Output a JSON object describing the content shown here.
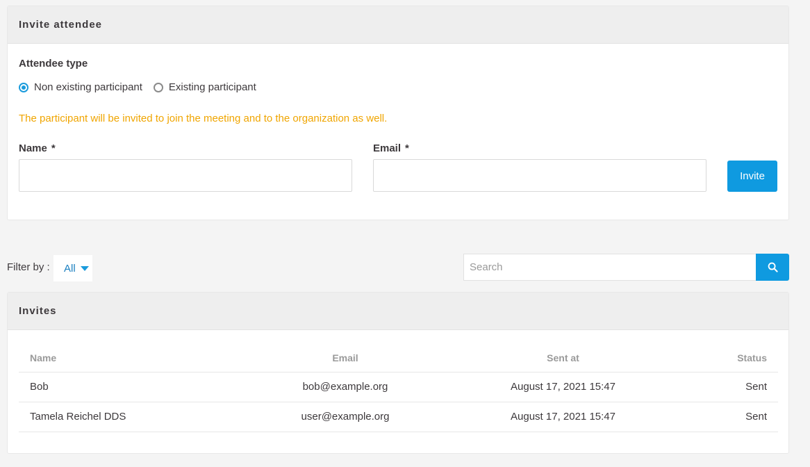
{
  "invite_card": {
    "title": "Invite attendee",
    "attendee_type_label": "Attendee type",
    "radio_options": [
      {
        "label": "Non existing participant",
        "checked": true
      },
      {
        "label": "Existing participant",
        "checked": false
      }
    ],
    "help_text": "The participant will be invited to join the meeting and to the organization as well.",
    "name_label": "Name",
    "email_label": "Email",
    "required_marker": "*",
    "name_value": "",
    "email_value": "",
    "invite_button": "Invite"
  },
  "filter": {
    "label": "Filter by :",
    "selected": "All"
  },
  "search": {
    "placeholder": "Search",
    "icon": "search-icon"
  },
  "invites_card": {
    "title": "Invites",
    "columns": [
      "Name",
      "Email",
      "Sent at",
      "Status"
    ],
    "rows": [
      {
        "name": "Bob",
        "email": "bob@example.org",
        "sent_at": "August 17, 2021 15:47",
        "status": "Sent"
      },
      {
        "name": "Tamela Reichel DDS",
        "email": "user@example.org",
        "sent_at": "August 17, 2021 15:47",
        "status": "Sent"
      }
    ]
  },
  "colors": {
    "accent": "#0f9ae0",
    "warning": "#f0a500",
    "header_bg": "#eeeeee",
    "page_bg": "#f4f4f4"
  }
}
